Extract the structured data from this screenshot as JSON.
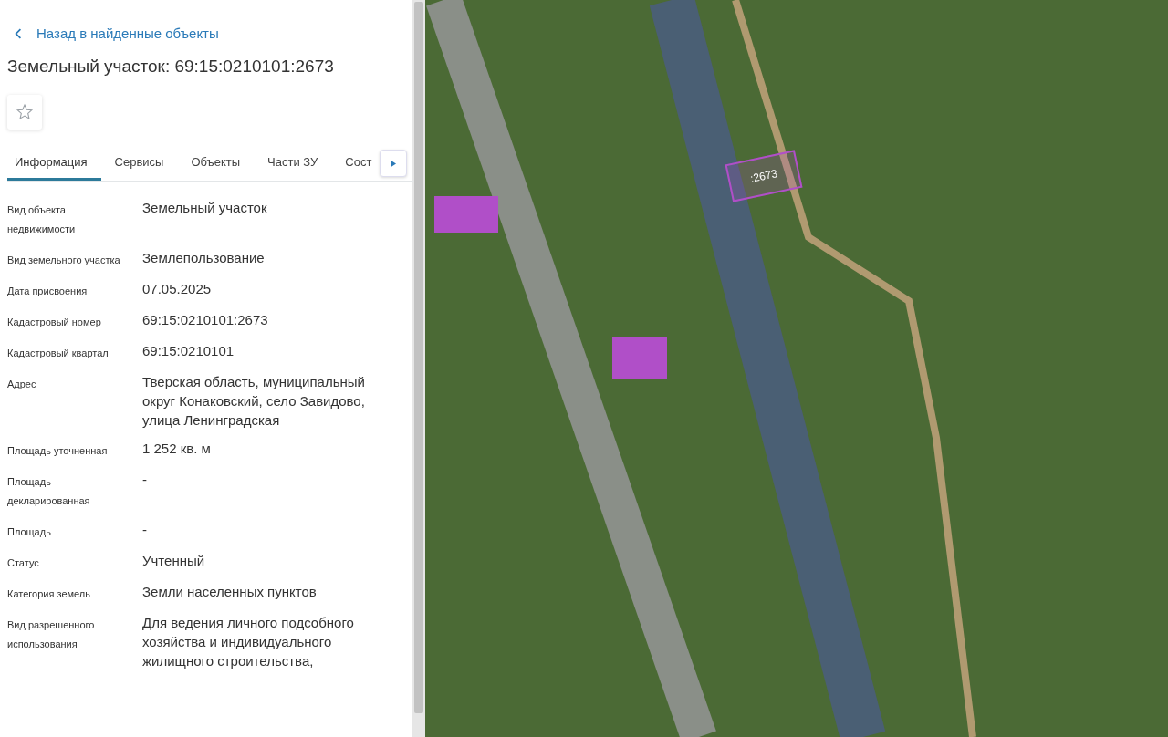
{
  "back_link": "Назад в найденные объекты",
  "title": "Земельный участок: 69:15:0210101:2673",
  "favorite": {
    "on": false
  },
  "tabs": [
    {
      "label": "Информация",
      "selected": true
    },
    {
      "label": "Сервисы",
      "selected": false
    },
    {
      "label": "Объекты",
      "selected": false
    },
    {
      "label": "Части ЗУ",
      "selected": false
    },
    {
      "label": "Сост",
      "selected": false
    }
  ],
  "fields": [
    {
      "label": "Вид объекта недвижимости",
      "value": "Земельный участок"
    },
    {
      "label": "Вид земельного участка",
      "value": "Землепользование"
    },
    {
      "label": "Дата присвоения",
      "value": "07.05.2025"
    },
    {
      "label": "Кадастровый номер",
      "value": "69:15:0210101:2673"
    },
    {
      "label": "Кадастровый квартал",
      "value": "69:15:0210101"
    },
    {
      "label": "Адрес",
      "value": "Тверская область, муниципальный округ Конаковский, село Завидово, улица Ленинградская"
    },
    {
      "label": "Площадь уточненная",
      "value": "1 252 кв. м"
    },
    {
      "label": "Площадь декларированная",
      "value": "-"
    },
    {
      "label": "Площадь",
      "value": "-"
    },
    {
      "label": "Статус",
      "value": "Учтенный"
    },
    {
      "label": "Категория земель",
      "value": "Земли населенных пунктов"
    },
    {
      "label": "Вид разрешенного использования",
      "value": "Для ведения личного подсобного хозяйства и индивидуального жилищного строительства,"
    }
  ],
  "map": {
    "parcel_label": ":2673"
  }
}
